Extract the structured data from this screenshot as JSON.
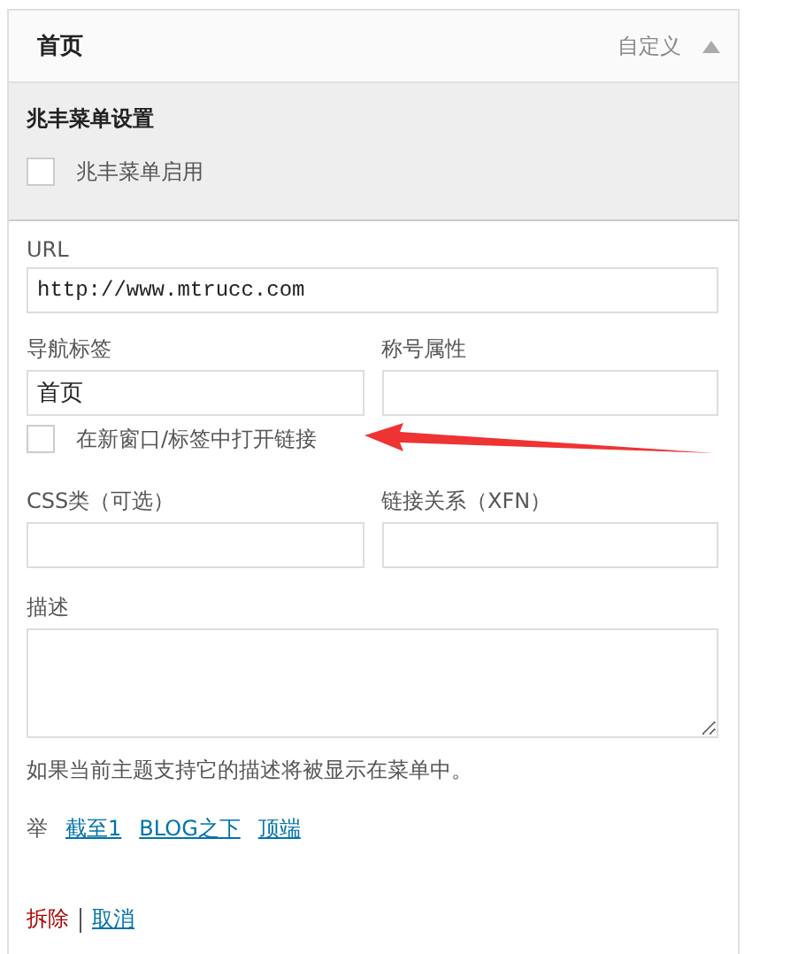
{
  "header": {
    "title": "首页",
    "type_label": "自定义",
    "expanded": true
  },
  "custom_settings": {
    "title": "兆丰菜单设置",
    "option": {
      "label": "兆丰菜单启用",
      "checked": false
    }
  },
  "url": {
    "label": "URL",
    "value": "http://www.mtrucc.com"
  },
  "nav_label": {
    "label": "导航标签",
    "value": "首页"
  },
  "title_attr": {
    "label": "称号属性"
  },
  "new_window": {
    "label": "在新窗口/标签中打开链接",
    "checked": false,
    "annotated": true
  },
  "css_classes": {
    "label": "CSS类（可选）"
  },
  "xfn": {
    "label": "链接关系（XFN）"
  },
  "description": {
    "label": "描述",
    "help": "如果当前主题支持它的描述将被显示在菜单中。"
  },
  "move": {
    "label": "举",
    "links": [
      "截至1",
      "BLOG之下",
      "顶端"
    ]
  },
  "actions": {
    "remove": "拆除",
    "cancel": "取消"
  }
}
